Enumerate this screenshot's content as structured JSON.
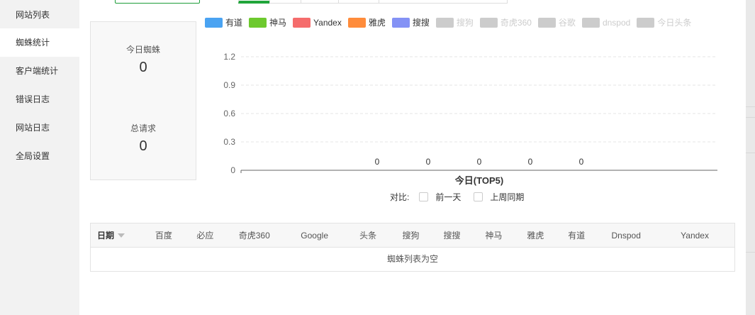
{
  "sidebar": {
    "items": [
      {
        "label": "网站列表",
        "active": false
      },
      {
        "label": "蜘蛛统计",
        "active": true
      },
      {
        "label": "客户端统计",
        "active": false
      },
      {
        "label": "错误日志",
        "active": false
      },
      {
        "label": "网站日志",
        "active": false
      },
      {
        "label": "全局设置",
        "active": false
      }
    ]
  },
  "stats": {
    "today_spider_label": "今日蜘蛛",
    "today_spider_value": "0",
    "total_requests_label": "总请求",
    "total_requests_value": "0"
  },
  "legend": [
    {
      "name": "有道",
      "color": "#4aa3f2",
      "active": true
    },
    {
      "name": "神马",
      "color": "#6dc92e",
      "active": true
    },
    {
      "name": "Yandex",
      "color": "#f56c6c",
      "active": true
    },
    {
      "name": "雅虎",
      "color": "#ff8c3b",
      "active": true
    },
    {
      "name": "搜搜",
      "color": "#8492f5",
      "active": true
    },
    {
      "name": "搜狗",
      "color": "#cccccc",
      "active": false
    },
    {
      "name": "奇虎360",
      "color": "#cccccc",
      "active": false
    },
    {
      "name": "谷歌",
      "color": "#cccccc",
      "active": false
    },
    {
      "name": "dnspod",
      "color": "#cccccc",
      "active": false
    },
    {
      "name": "今日头条",
      "color": "#cccccc",
      "active": false
    }
  ],
  "chart_data": {
    "type": "bar",
    "xlabel": "今日(TOP5)",
    "ylim": [
      0,
      1.2
    ],
    "yticks": [
      "0",
      "0.3",
      "0.6",
      "0.9",
      "1.2"
    ],
    "grid": true,
    "values": [
      0,
      0,
      0,
      0,
      0
    ],
    "data_labels": [
      "0",
      "0",
      "0",
      "0",
      "0"
    ]
  },
  "compare": {
    "label": "对比:",
    "option1": "前一天",
    "option2": "上周同期"
  },
  "table": {
    "columns": [
      "日期",
      "百度",
      "必应",
      "奇虎360",
      "Google",
      "头条",
      "搜狗",
      "搜搜",
      "神马",
      "雅虎",
      "有道",
      "Dnspod",
      "Yandex"
    ],
    "empty_text": "蜘蛛列表为空"
  }
}
